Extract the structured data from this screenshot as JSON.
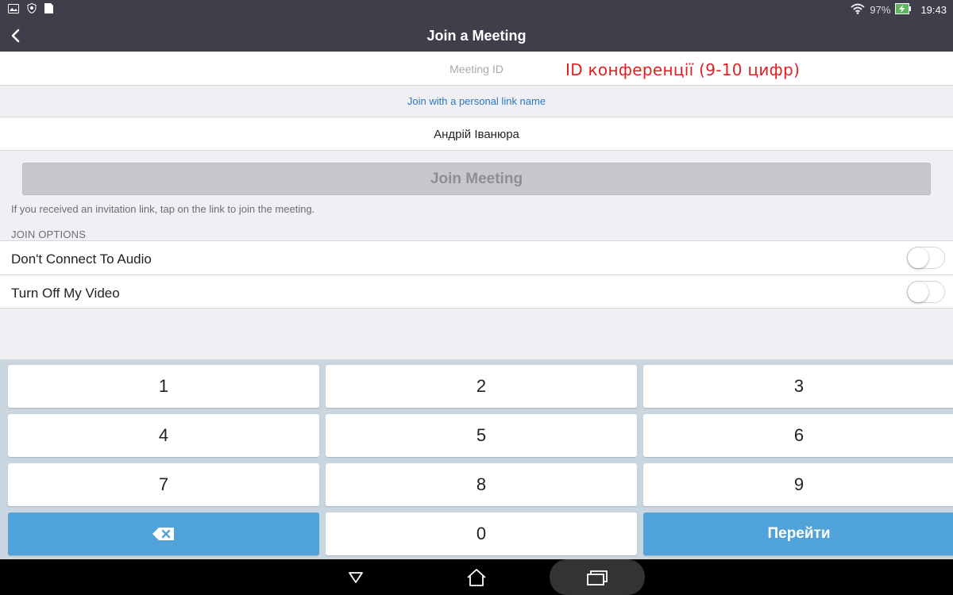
{
  "statusbar": {
    "battery": "97%",
    "time": "19:43"
  },
  "header": {
    "title": "Join a Meeting"
  },
  "meeting_id": {
    "placeholder": "Meeting ID",
    "annotation": "ID конференції (9-10 цифр)"
  },
  "personal_link": {
    "label": "Join with a personal link name"
  },
  "name_field": {
    "value": "Андрій Іванюра"
  },
  "join_button": {
    "label": "Join Meeting"
  },
  "hint": "If you received an invitation link, tap on the link to join the meeting.",
  "join_options": {
    "section_label": "JOIN OPTIONS",
    "items": [
      {
        "label": "Don't Connect To Audio",
        "enabled": false
      },
      {
        "label": "Turn Off My Video",
        "enabled": false
      }
    ]
  },
  "keypad": {
    "keys": [
      "1",
      "2",
      "3",
      "4",
      "5",
      "6",
      "7",
      "8",
      "9",
      "0"
    ],
    "go_label": "Перейти"
  },
  "colors": {
    "bar_bg": "#3e3f4b",
    "key_blue": "#4fa3d8",
    "annotation_red": "#e02020",
    "link_blue": "#2b78c2"
  }
}
